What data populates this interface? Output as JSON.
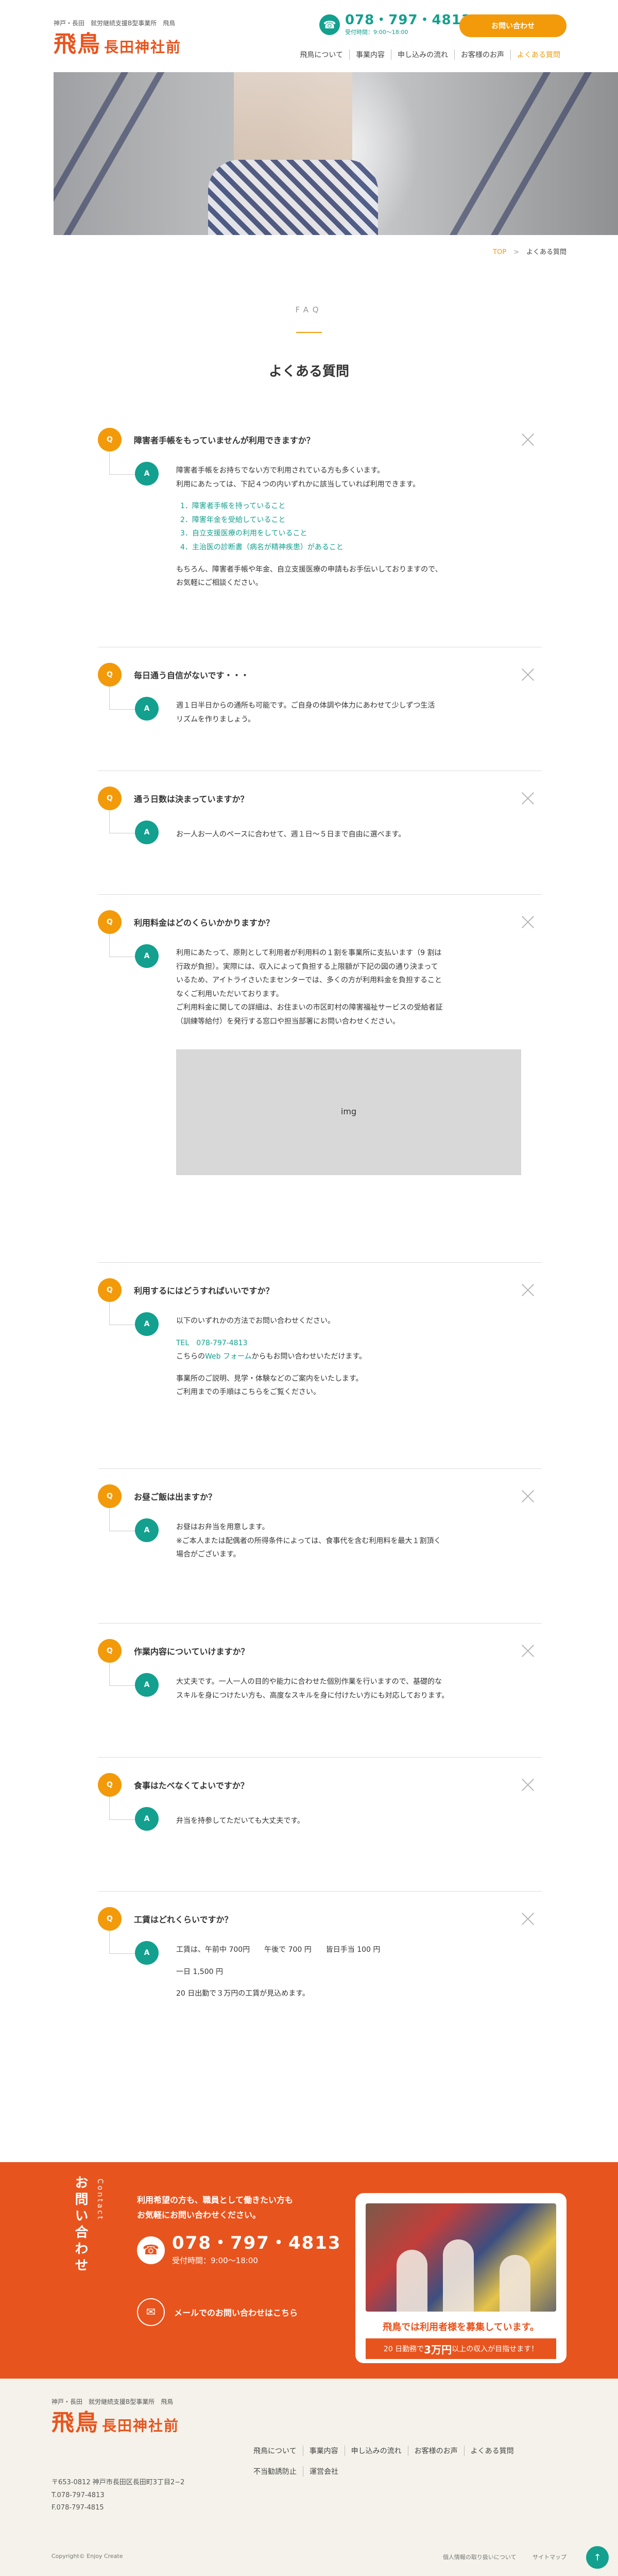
{
  "header": {
    "tagline": "神戸・長田　就労継続支援B型事業所　飛鳥",
    "logo_main": "飛鳥",
    "logo_sub": "長田神社前",
    "phone": "078・797・4813",
    "hours": "受付時間：9:00～18:00",
    "contact_button": "お問い合わせ",
    "nav": [
      "飛鳥について",
      "事業内容",
      "申し込みの流れ",
      "お客様のお声",
      "よくある質問"
    ]
  },
  "breadcrumb": {
    "home": "TOP",
    "separator": ">",
    "current": "よくある質問"
  },
  "section": {
    "en": "FAQ",
    "title": "よくある質問"
  },
  "labels": {
    "q": "Q",
    "a": "A"
  },
  "faq": [
    {
      "q": "障害者手帳をもっていませんが利用できますか？",
      "a1": "障害者手帳をお持ちでない方で利用されている方も多くいます。",
      "a2": "利用にあたっては、下記４つの内いずれかに該当していれば利用できます。",
      "list": [
        "1．障害者手帳を持っていること",
        "2．障害年金を受給していること",
        "3．自立支援医療の利用をしていること",
        "4．主治医の診断書（病名が精神疾患）があること"
      ],
      "a3": "もちろん、障害者手帳や年金、自立支援医療の申請もお手伝いしておりますので、",
      "a4": "お気軽にご相談ください。"
    },
    {
      "q": "毎日通う自信がないです・・・",
      "a1": "週１日半日からの通所も可能です。ご自身の体調や体力にあわせて少しずつ生活",
      "a2": "リズムを作りましょう。"
    },
    {
      "q": "通う日数は決まっていますか？",
      "a1": "お一人お一人のペースに合わせて、週１日～５日まで自由に選べます。"
    },
    {
      "q": "利用料金はどのくらいかかりますか？",
      "a1": "利用にあたって、原則として利用者が利用料の１割を事業所に支払います（9 割は",
      "a2": "行政が負担）。実際には、収入によって負担する上限額が下記の図の通り決まって",
      "a3": "いるため、アイトライさいたまセンターでは、多くの方が利用料金を負担すること",
      "a4": "なくご利用いただいております。",
      "a5": "ご利用料金に関しての詳細は、お住まいの市区町村の障害福祉サービスの受給者証",
      "a6": "（訓練等給付）を発行する窓口や担当部署にお問い合わせください。",
      "img": "img"
    },
    {
      "q": "利用するにはどうすればいいですか？",
      "a1": "以下のいずれかの方法でお問い合わせください。",
      "tel_label": "TEL　078-797-4813",
      "form_pre": "こちらの",
      "form_link": "Web フォーム",
      "form_post": "からもお問い合わせいただけます。",
      "a2": "事業所のご説明、見学・体験などのご案内をいたします。",
      "a3": "ご利用までの手順はこちらをご覧ください。"
    },
    {
      "q": "お昼ご飯は出ますか？",
      "a1": "お昼はお弁当を用意します。",
      "a2": "※ご本人または配偶者の所得条件によっては、食事代を含む利用料を最大１割頂く",
      "a3": "場合がございます。"
    },
    {
      "q": "作業内容についていけますか？",
      "a1": "大丈夫です。一人一人の目的や能力に合わせた個別作業を行いますので、基礎的な",
      "a2": "スキルを身につけたい方も、高度なスキルを身に付けたい方にも対応しております。"
    },
    {
      "q": "食事はたべなくてよいですか？",
      "a1": "弁当を持参してただいても大丈夫です。"
    },
    {
      "q": "工賃はどれくらいですか？",
      "a1": "工賃は、午前中 700円　　午後で 700 円　　皆日手当 100 円",
      "a2": "一日 1,500 円",
      "a3": "20 日出勤で３万円の工賃が見込めます。"
    }
  ],
  "contact": {
    "title_jp": "お問い合わせ",
    "title_en": "Contact",
    "lead1": "利用希望の方も、職員として働きたい方も",
    "lead2": "お気軽にお問い合わせください。",
    "phone": "078・797・4813",
    "hours": "受付時間：9:00～18:00",
    "mail": "メールでのお問い合わせはこちら",
    "card_text1": "飛鳥では利用者様を募集しています。",
    "card_pre": "20 日勤務で",
    "card_bold": "3万円",
    "card_post": "以上の収入が目指せます！"
  },
  "footer": {
    "tagline": "神戸・長田　就労継続支援B型事業所　飛鳥",
    "logo_main": "飛鳥",
    "logo_sub": "長田神社前",
    "address": "〒653-0812 神戸市長田区長田町3丁目2−2",
    "tel": "T.078-797-4813",
    "fax": "F.078-797-4815",
    "nav_row1": [
      "飛鳥について",
      "事業内容",
      "申し込みの流れ",
      "お客様のお声",
      "よくある質問"
    ],
    "nav_row2": [
      "不当勧誘防止",
      "運営会社"
    ],
    "copyright": "Copyright© Enjoy Create",
    "link_privacy": "個人情報の取り扱いについて",
    "link_sitemap": "サイトマップ"
  },
  "colors": {
    "orange": "#f29a0a",
    "red_orange": "#e8541e",
    "teal": "#13a08e"
  },
  "icons": {
    "phone": "phone-icon",
    "mail": "mail-icon",
    "close": "close-icon",
    "pagetop": "arrow-up-icon"
  }
}
